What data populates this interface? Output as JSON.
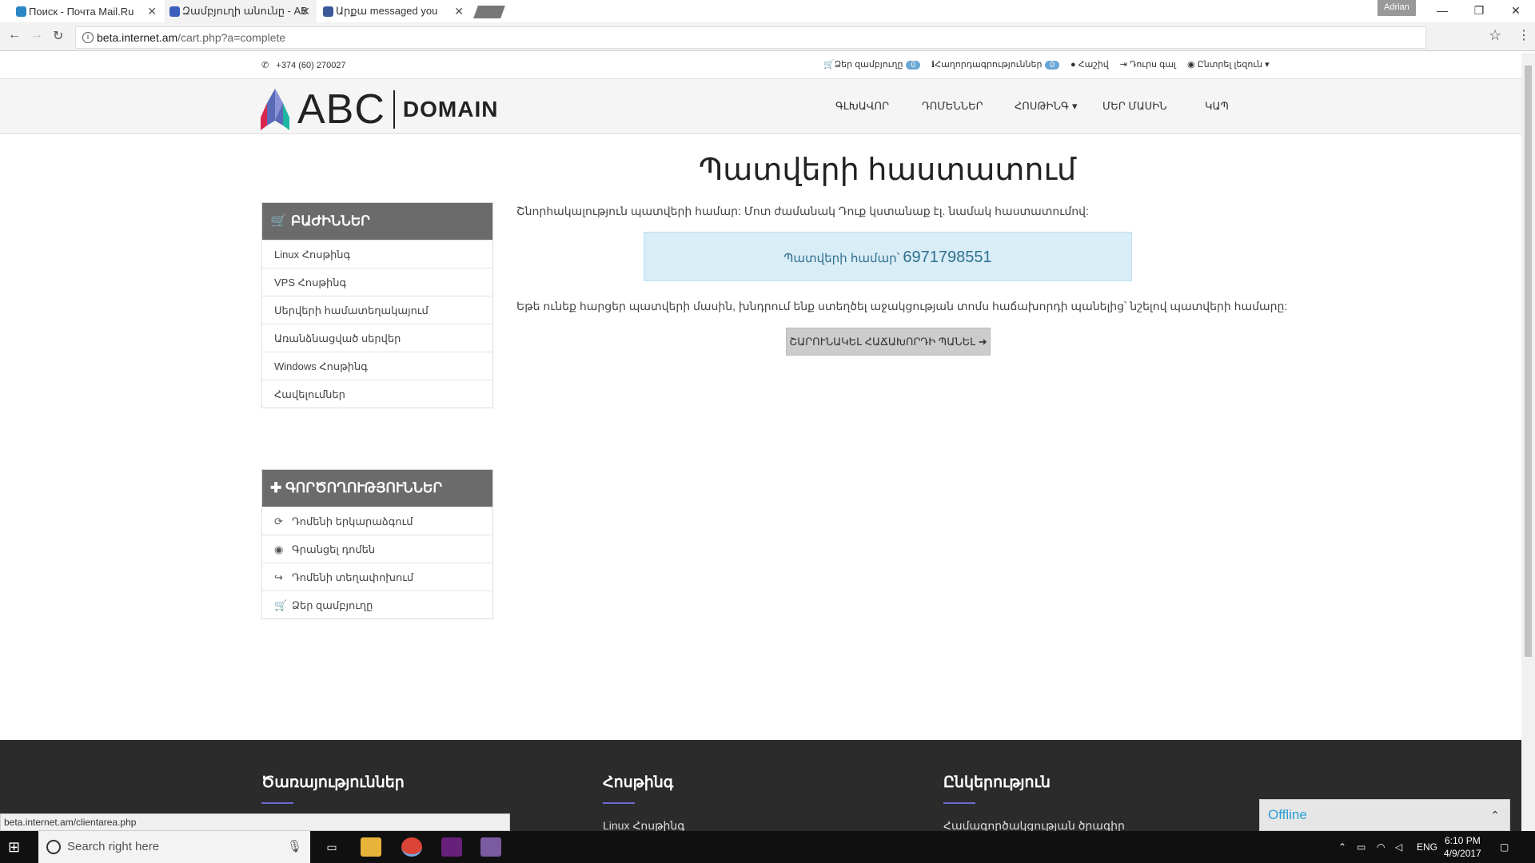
{
  "browser": {
    "tabs": [
      {
        "title": "Поиск - Почта Mail.Ru",
        "color": "#2b86c5"
      },
      {
        "title": "Զամբյուղի անունը - AB",
        "color": "#3a5fbf"
      },
      {
        "title": "Արքա messaged you",
        "color": "#3b5998"
      }
    ],
    "user": "Adrian",
    "url_host": "beta.internet.am",
    "url_path": "/cart.php?a=complete",
    "status_url": "beta.internet.am/clientarea.php"
  },
  "topbar": {
    "phone": "+374 (60) 270027",
    "cart_label": "Ձեր զամբյուղը",
    "cart_count": "0",
    "notifications_label": "Հաղորդագրություններ",
    "notifications_count": "0",
    "account_label": "Հաշիվ",
    "logout_label": "Դուրս գալ",
    "language_label": "Ընտրել լեզուն"
  },
  "logo": {
    "abc": "ABC",
    "domain": "DOMAIN"
  },
  "nav": [
    "ԳԼԽԱՎՈՐ",
    "ԴՈՄԵՆՆԵՐ",
    "ՀՈՍԹԻՆԳ",
    "ՄԵՐ ՄԱՍԻՆ",
    "ԿԱՊ"
  ],
  "sidebar": {
    "sections_title": "ԲԱԺԻՆՆԵՐ",
    "sections": [
      "Linux Հոսթինգ",
      "VPS Հոսթինգ",
      "Սերվերի համատեղակայում",
      "Առանձնացված սերվեր",
      "Windows Հոսթինգ",
      "Հավելումներ"
    ],
    "actions_title": "ԳՈՐԾՈՂՈՒԹՅՈՒՆՆԵՐ",
    "actions": [
      {
        "label": "Դոմենի երկարաձգում",
        "icon": "refresh-icon"
      },
      {
        "label": "Գրանցել դոմեն",
        "icon": "globe-icon"
      },
      {
        "label": "Դոմենի տեղափոխում",
        "icon": "share-icon"
      },
      {
        "label": "Ձեր զամբյուղը",
        "icon": "cart-icon"
      }
    ]
  },
  "main": {
    "title": "Պատվերի հաստատում",
    "lead": "Շնորհակալություն պատվերի համար: Մոտ ժամանակ Դուք կստանաք էլ. նամակ հաստատումով:",
    "order_label": "Պատվերի համար՝",
    "order_number": "6971798551",
    "help_text": "Եթե ունեք հարցեր պատվերի մասին, խնդրում ենք ստեղծել աջակցության տոմս հաճախորդի պանելից՝ նշելով պատվերի համարը:",
    "button": "ՇԱՐՈՒՆԱԿԵԼ ՀԱՃԱԽՈՐԴԻ ՊԱՆԵԼ"
  },
  "footer": {
    "cols": [
      {
        "title": "Ծառայություններ",
        "link": ""
      },
      {
        "title": "Հոսթինգ",
        "link": "Linux Հոսթինգ"
      },
      {
        "title": "Ընկերություն",
        "link": "Համագործակցության ծրագիր"
      }
    ]
  },
  "chat": {
    "label": "Offline"
  },
  "taskbar": {
    "search_placeholder": "Search right here",
    "lang": "ENG",
    "time": "6:10 PM",
    "date": "4/9/2017"
  }
}
